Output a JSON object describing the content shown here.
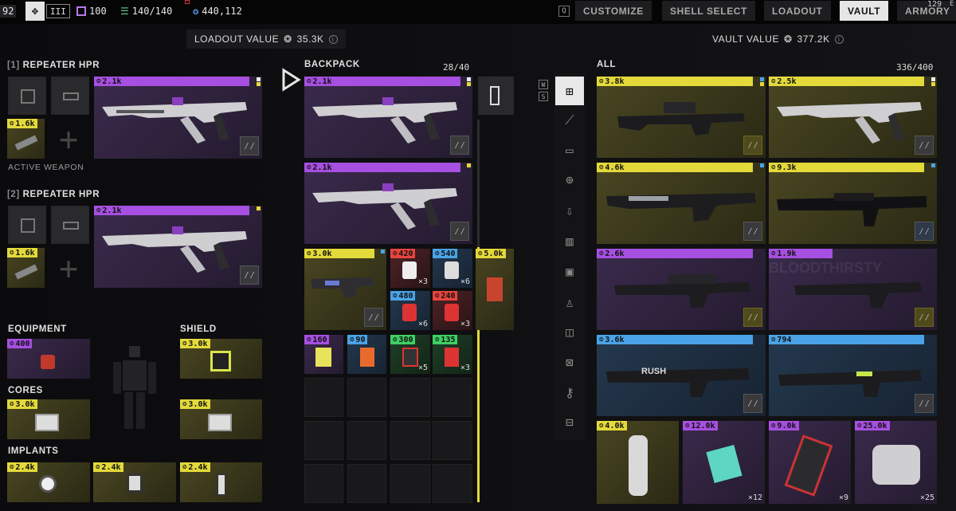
{
  "topbar": {
    "level": "92",
    "rank": "III",
    "stat_a": "100",
    "stat_b": "140/140",
    "currency": "440,112",
    "key_hint": "Q",
    "nav": [
      {
        "label": "CUSTOMIZE",
        "active": false
      },
      {
        "label": "SHELL SELECT",
        "active": false
      },
      {
        "label": "LOADOUT",
        "active": false
      },
      {
        "label": "VAULT",
        "active": true
      },
      {
        "label": "ARMORY",
        "active": false
      }
    ],
    "corner_text": "129",
    "corner_key": "E"
  },
  "loadout": {
    "value_label": "LOADOUT VALUE",
    "value": "35.3K",
    "info_icon": "i",
    "weapons": [
      {
        "slot": "[1]",
        "name": "REPEATER HPR",
        "price": "2.1k",
        "mod_price": "1.6k",
        "status": "ACTIVE WEAPON"
      },
      {
        "slot": "[2]",
        "name": "REPEATER HPR",
        "price": "2.1k",
        "mod_price": "1.6k"
      }
    ],
    "equipment_label": "EQUIPMENT",
    "equipment_price": "400",
    "shield_label": "SHIELD",
    "shield_price": "3.0k",
    "cores_label": "CORES",
    "cores": [
      "3.0k",
      "3.0k"
    ],
    "implants_label": "IMPLANTS",
    "implants": [
      "2.4k",
      "2.4k",
      "2.4k"
    ]
  },
  "backpack": {
    "title": "BACKPACK",
    "count": "28/40",
    "ws": [
      "W",
      "S"
    ],
    "items": [
      {
        "price": "2.1k",
        "bar": "purple"
      },
      {
        "price": "2.1k",
        "bar": "purple"
      },
      {
        "price": "3.0k",
        "bar": "yellow"
      },
      {
        "price": "420",
        "bar": "red",
        "qty": "×3"
      },
      {
        "price": "540",
        "bar": "blue",
        "qty": "×6"
      },
      {
        "price": "5.0k",
        "bar": "yellow"
      },
      {
        "price": "480",
        "bar": "blue",
        "qty": "×6"
      },
      {
        "price": "240",
        "bar": "red",
        "qty": "×3"
      },
      {
        "price": "160",
        "bar": "purple"
      },
      {
        "price": "90",
        "bar": "blue"
      },
      {
        "price": "300",
        "bar": "green",
        "qty": "×5"
      },
      {
        "price": "135",
        "bar": "green",
        "qty": "×3"
      }
    ]
  },
  "vault": {
    "value_label": "VAULT VALUE",
    "value": "377.2K",
    "section": "ALL",
    "count": "336/400",
    "items": [
      {
        "price": "3.8k",
        "bar": "yellow"
      },
      {
        "price": "2.5k",
        "bar": "yellow"
      },
      {
        "price": "4.6k",
        "bar": "yellow"
      },
      {
        "price": "9.3k",
        "bar": "yellow"
      },
      {
        "price": "2.6k",
        "bar": "purple"
      },
      {
        "price": "1.9k",
        "bar": "purple"
      },
      {
        "price": "3.6k",
        "bar": "blue"
      },
      {
        "price": "794",
        "bar": "blue"
      },
      {
        "price": "4.0k",
        "bar": "yellow"
      },
      {
        "price": "12.0k",
        "bar": "purple",
        "qty": "×12"
      },
      {
        "price": "9.0k",
        "bar": "purple",
        "qty": "×9"
      },
      {
        "price": "25.0k",
        "bar": "purple",
        "qty": "×25"
      }
    ],
    "bg_text": "BLOODTHIRSTY",
    "gun_labels": [
      "RUSH"
    ]
  },
  "categories": [
    "all-icon",
    "syringe-icon",
    "canister-icon",
    "medkit-icon",
    "download-icon",
    "ammo-icon",
    "chip-icon",
    "body-icon",
    "core-icon",
    "cross-box-icon",
    "key-icon",
    "case-icon"
  ],
  "colors": {
    "purple": "#a64fe0",
    "yellow": "#e3d93a",
    "blue": "#4aa3e6",
    "red": "#e8443e",
    "green": "#3fcf63"
  }
}
